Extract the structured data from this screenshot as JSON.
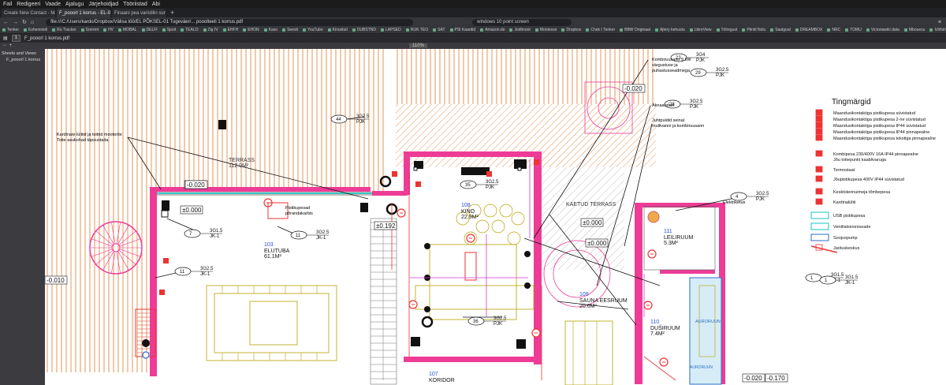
{
  "menu": [
    "Fail",
    "Redigeeri",
    "Vaade",
    "Ajalugu",
    "Järjehoidjad",
    "Tööriistad",
    "Abi"
  ],
  "tabs": [
    {
      "label": "Create New Contact - Mailsto...",
      "active": false
    },
    {
      "label": "F_pooorl 1 korrus - EL-01 Tugeväer",
      "active": true
    },
    {
      "label": "Finaani pea varistilin sumendlor...",
      "active": false
    }
  ],
  "address": "file:///C:/Users/kardo/Dropbox/Välisa töö/EL PÕKSEL-01 Tugeväer/... pooolteeli 1 korrus.pdf",
  "find_field": "windows 10 point screen",
  "bookmarks": [
    "Tenker",
    "Eshenisteli",
    "Ru Tracker",
    "Sorrent",
    "HV",
    "MOBAL",
    "DELFI",
    "Spoit",
    "TEALO",
    "Zig IV",
    "EHFH",
    "EHON",
    "Kaso",
    "Seesti",
    "YouTube",
    "Kinostuti",
    "DUBSTND",
    "LAPSED",
    "RIJK TEO",
    "SAT",
    "PSI Kaardid",
    "Amazon.de",
    "Jodlmoot",
    "Montesse",
    "Dropbox",
    "Chek I Tenker",
    "BBW Originaal",
    "Ajtery kehustu",
    "LibreView",
    "Tölregust",
    "Ptintil Nolu",
    "Saulgoal",
    "DREAMBOX",
    "NRC",
    "TOMU",
    "Victoriawiki data",
    "Mbouesu",
    "Ichfish",
    "Kaatmine",
    "APU FOGS",
    "Parklinnt",
    "Eesti",
    "Discord",
    "AppCubu",
    "ELKOMEERIMA"
  ],
  "pdf": {
    "file_label": "F_pooorl 1 korrus.pdf",
    "page_box": "1",
    "zoom": "110%"
  },
  "sidebar_items": [
    "Sheets and Views",
    "F_pooorl 1 korrus"
  ],
  "rooms": [
    {
      "num": "103",
      "name": "ELUTUBA",
      "area": "61.1M²"
    },
    {
      "num": "108",
      "name": "KINO",
      "area": "22.9M²"
    },
    {
      "num": "111",
      "name": "LEILIRUUM",
      "area": "5.3M²"
    },
    {
      "num": "109",
      "name": "SAUNA EESRUUM",
      "area": "20.6M²"
    },
    {
      "num": "110",
      "name": "DUŠIRUUM",
      "area": "7.4M²"
    },
    {
      "num": "107",
      "name": "KORIDOR",
      "area": ""
    }
  ],
  "plan_text": {
    "terrass": "TERRASS",
    "terrass_area": "112.0M²",
    "katud": "KAETUD TERRASS",
    "auroru": "AURORUUN",
    "leiliruum_label": "AURORUUN",
    "kardinate": "Kardinate lülitid ja toitrid mootorite\nToite asukohad täpsustada",
    "kombinuumen": "Kombiruusann 9 kW\nvärgustuse ja\npuhastusseadmega",
    "aknaanduri": "Aknaanduri",
    "juhtpuldid": "Juhtpuldid seinal\nmullivanni ja kombiruusann",
    "pistikupesad": "Pistikupesad\npõrandakarbis",
    "eleektr": "Elektriketus"
  },
  "levels": [
    "-0.020",
    "±0.000",
    "-0.010",
    "±0.000",
    "±0.192",
    "±0.000",
    "-0.020",
    "-0.170",
    "±0.000",
    "-0.020"
  ],
  "tags": [
    {
      "n": "23",
      "a": "3G4",
      "b": "PJK"
    },
    {
      "n": "29",
      "a": "3G2.5",
      "b": "PJK"
    },
    {
      "n": "28",
      "a": "3G2.5",
      "b": "PJK"
    },
    {
      "n": "44",
      "a": "3G2.5",
      "b": "PJK"
    },
    {
      "n": "35",
      "a": "3G2.5",
      "b": "PJK"
    },
    {
      "n": "4",
      "a": "3G2.5",
      "b": "PJK"
    },
    {
      "n": "7",
      "a": "3G1.5",
      "b": "JK-1"
    },
    {
      "n": "11",
      "a": "3G2.5",
      "b": "JK-1"
    },
    {
      "n": "11",
      "a": "3G2.5",
      "b": "JK-1"
    },
    {
      "n": "36",
      "a": "3G2.5",
      "b": "PJK"
    },
    {
      "n": "1",
      "a": "3G1.5",
      "b": "JK-1"
    },
    {
      "n": "1",
      "a": "3G1.5",
      "b": "JK-1"
    }
  ],
  "legend": {
    "title": "Tingmärgid",
    "items": [
      "Maandusikontaktiga pistikupesa süvistatud",
      "Maandusikontaktiga pistikupesa 2-ne süvistatud",
      "Maandusikontaktiga pistikupesa IP44 süvistatud",
      "Maandusikontaktiga pistikupesa IP44 pinnapealne",
      "Maandusikontaktiga pistikupesa tekstiga pinnapealne",
      "Kombipesa 230/400V 16A IP44 pinnapealne\nJõu toitepunkt kaablivaruga",
      "Termostaat",
      "Jõupistikupesa 400V IP44 süvistatud",
      "Kesktolerinuimeja tõmbepesa",
      "Kardinalüliti",
      "USB pistikupesa",
      "Ventilatsiooniseade",
      "Soojuspump",
      "Jaotuskeskus"
    ]
  },
  "colors": {
    "wall": "#ee3c96",
    "hatch": "#e07a2a",
    "furniture": "#b5a200",
    "grid": "#888",
    "cable": "#000",
    "cyan": "#16c6c6"
  }
}
